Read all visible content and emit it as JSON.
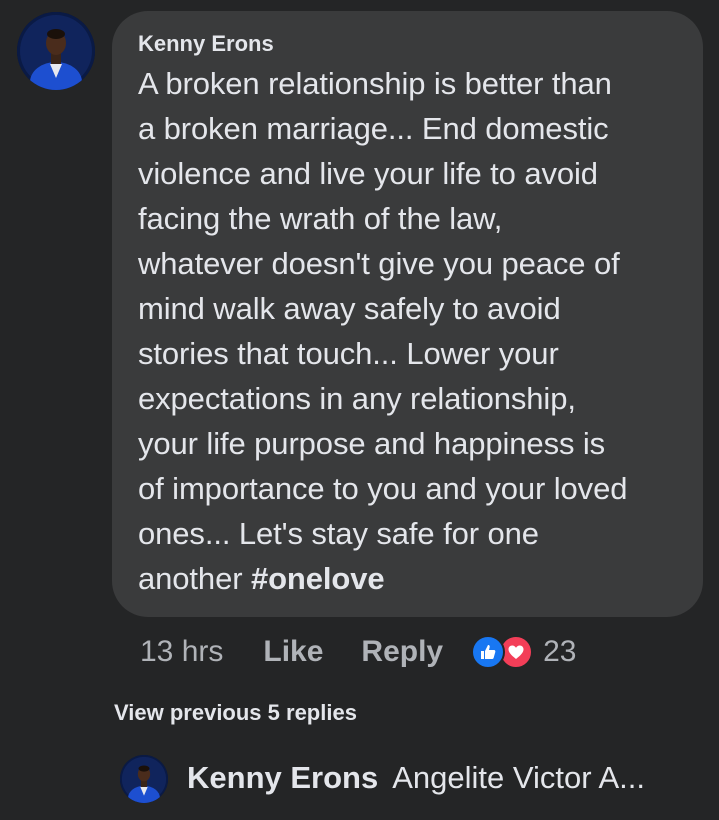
{
  "comment": {
    "author": "Kenny Erons",
    "text_lines": [
      "A broken relationship is better than",
      "a broken marriage... End domestic",
      "violence and live your life to avoid",
      "facing the wrath of the law,",
      "whatever doesn't give you peace of",
      "mind walk away safely to avoid",
      "stories that touch... Lower your",
      "expectations in any relationship,",
      "your life purpose and happiness is",
      "of importance to you and your loved",
      "ones... Let's stay safe for one"
    ],
    "last_line_prefix": "another ",
    "hashtag": "#onelove",
    "time": "13 hrs",
    "like_label": "Like",
    "reply_label": "Reply",
    "reaction_count": "23",
    "reactions": [
      "like-icon",
      "love-icon"
    ]
  },
  "view_previous": "View previous 5 replies",
  "reply_preview": {
    "author": "Kenny Erons",
    "text": "Angelite Victor A..."
  },
  "colors": {
    "background": "#242526",
    "bubble": "#3a3b3c",
    "text": "#e4e6eb",
    "muted": "#b0b3b8",
    "like_blue": "#1877f2",
    "love_red": "#f33e58"
  }
}
